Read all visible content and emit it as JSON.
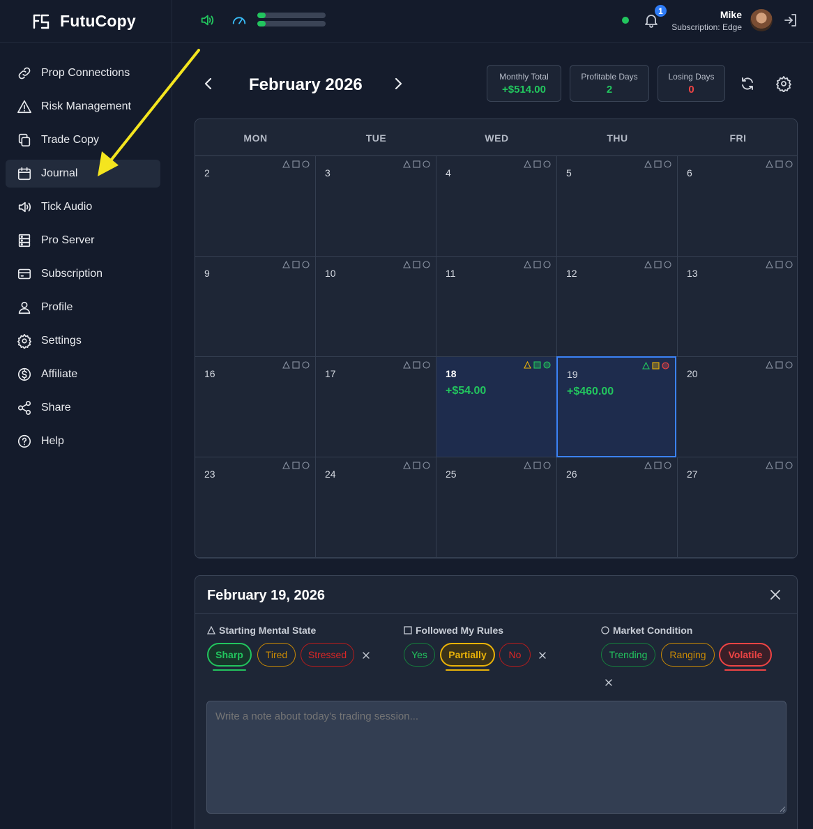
{
  "app": {
    "name": "FutuCopy"
  },
  "topbar": {
    "notifications_count": "1",
    "user_name": "Mike",
    "subscription": "Subscription: Edge",
    "audio_levels": [
      0.12,
      0.12
    ]
  },
  "sidebar": {
    "items": [
      {
        "label": "Prop Connections",
        "icon": "link-icon"
      },
      {
        "label": "Risk Management",
        "icon": "warning-icon"
      },
      {
        "label": "Trade Copy",
        "icon": "copy-icon"
      },
      {
        "label": "Journal",
        "icon": "calendar-icon",
        "active": true
      },
      {
        "label": "Tick Audio",
        "icon": "speaker-icon"
      },
      {
        "label": "Pro Server",
        "icon": "server-icon"
      },
      {
        "label": "Subscription",
        "icon": "card-icon"
      },
      {
        "label": "Profile",
        "icon": "user-icon"
      },
      {
        "label": "Settings",
        "icon": "gear-icon"
      },
      {
        "label": "Affiliate",
        "icon": "dollar-icon"
      },
      {
        "label": "Share",
        "icon": "share-icon"
      },
      {
        "label": "Help",
        "icon": "help-icon"
      }
    ]
  },
  "calendar": {
    "month_title": "February 2026",
    "stats": {
      "monthly_total_label": "Monthly Total",
      "monthly_total_value": "+$514.00",
      "profitable_days_label": "Profitable Days",
      "profitable_days_value": "2",
      "losing_days_label": "Losing Days",
      "losing_days_value": "0"
    },
    "weekdays": [
      "MON",
      "TUE",
      "WED",
      "THU",
      "FRI"
    ],
    "weeks": [
      [
        {
          "day": "2"
        },
        {
          "day": "3"
        },
        {
          "day": "4"
        },
        {
          "day": "5"
        },
        {
          "day": "6"
        }
      ],
      [
        {
          "day": "9"
        },
        {
          "day": "10"
        },
        {
          "day": "11"
        },
        {
          "day": "12"
        },
        {
          "day": "13"
        }
      ],
      [
        {
          "day": "16"
        },
        {
          "day": "17"
        },
        {
          "day": "18",
          "pnl": "+$54.00",
          "traded": true,
          "marks": [
            "#eab308",
            "#22c55e",
            "#22c55e"
          ]
        },
        {
          "day": "19",
          "pnl": "+$460.00",
          "traded": true,
          "selected": true,
          "marks": [
            "#22c55e",
            "#eab308",
            "#ef4444"
          ]
        },
        {
          "day": "20"
        }
      ],
      [
        {
          "day": "23"
        },
        {
          "day": "24"
        },
        {
          "day": "25"
        },
        {
          "day": "26"
        },
        {
          "day": "27"
        }
      ]
    ]
  },
  "day_panel": {
    "title": "February 19, 2026",
    "groups": [
      {
        "label": "Starting Mental State",
        "shape": "triangle",
        "options": [
          {
            "label": "Sharp",
            "color": "#22c55e",
            "selected": true
          },
          {
            "label": "Tired",
            "color": "#ca8a04"
          },
          {
            "label": "Stressed",
            "color": "#dc2626"
          }
        ]
      },
      {
        "label": "Followed My Rules",
        "shape": "square",
        "options": [
          {
            "label": "Yes",
            "color": "#22c55e"
          },
          {
            "label": "Partially",
            "color": "#eab308",
            "selected": true
          },
          {
            "label": "No",
            "color": "#dc2626"
          }
        ]
      },
      {
        "label": "Market Condition",
        "shape": "circle",
        "options": [
          {
            "label": "Trending",
            "color": "#22c55e"
          },
          {
            "label": "Ranging",
            "color": "#ca8a04"
          },
          {
            "label": "Volatile",
            "color": "#ef4444",
            "selected": true
          }
        ]
      }
    ],
    "note_placeholder": "Write a note about today's trading session..."
  },
  "colors": {
    "accent_blue": "#3b82f6",
    "positive": "#22c55e",
    "negative": "#ef4444",
    "annotation_arrow": "#f4e51f"
  }
}
